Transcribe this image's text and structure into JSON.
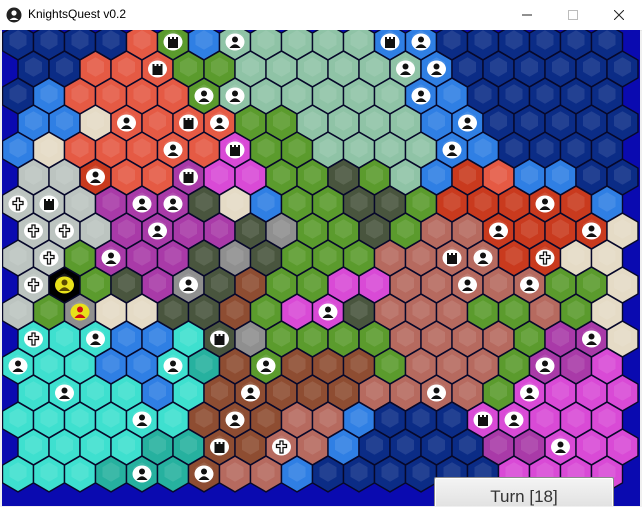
{
  "window": {
    "title": "KnightsQuest v0.2",
    "controls": {
      "minimize_icon": "minimize-icon",
      "maximize_icon": "maximize-icon",
      "close_icon": "close-icon"
    }
  },
  "map": {
    "cols": 20,
    "rows": 17,
    "terrain_colors": {
      "O": "#0b2c86",
      "W": "#2f7fe4",
      "R": "#e55a44",
      "D": "#c93a1e",
      "M": "#d94ad6",
      "P": "#a93aa8",
      "G": "#5b9b2d",
      "E": "#8fc3a6",
      "F": "#49553e",
      "S": "#e5dbc6",
      "K": "#bcc4c0",
      "T": "#3ee0cf",
      "C": "#26b19f",
      "B": "#8e4d32",
      "r": "#b66a5f",
      "L": "#8f8f8f"
    },
    "terrain": [
      "OOOORGWEEEEEWWOOOOOO",
      "OORRRGGEEEEEEWOOOOOO",
      "OWRRRRGEEEEEEWWOOOOO",
      "WWSRRRRGGEEEEWWOOOOO",
      "WSRRRRRMGGEEEEWWOOOO",
      "KKDRRPMMGGFGEWDRWWOO",
      "KKKPPPFSWGGFFGDDDDDW",
      "KKKPPPPFLGGFGrrDDDDS",
      "KKGPPPFLFGGGrrrrDDSS",
      "KYGFPLFBGGMMrrrrrGGS",
      "KGLSSFFBGMMFrrrGGrGS",
      "TTTWWTFLGGGGrrrrGPPS",
      "TTTWWTCBGBBBGrrrGPPM",
      "TTTTWTBBBBBrrrrGMMMM",
      "TTTTTTBBBrrWOOOMMMMM",
      "TTTTCCBBrrWOOOOPPMMM",
      "TTTCCCBrrWOOOOOOMMMM"
    ],
    "units": [
      {
        "col": 5,
        "row": 0,
        "kind": "castle"
      },
      {
        "col": 7,
        "row": 0,
        "kind": "warrior"
      },
      {
        "col": 12,
        "row": 0,
        "kind": "castle"
      },
      {
        "col": 13,
        "row": 0,
        "kind": "warrior"
      },
      {
        "col": 4,
        "row": 1,
        "kind": "castle"
      },
      {
        "col": 12,
        "row": 1,
        "kind": "warrior"
      },
      {
        "col": 13,
        "row": 1,
        "kind": "warrior"
      },
      {
        "col": 6,
        "row": 2,
        "kind": "warrior"
      },
      {
        "col": 7,
        "row": 2,
        "kind": "warrior"
      },
      {
        "col": 13,
        "row": 2,
        "kind": "warrior"
      },
      {
        "col": 3,
        "row": 3,
        "kind": "warrior"
      },
      {
        "col": 5,
        "row": 3,
        "kind": "tower"
      },
      {
        "col": 6,
        "row": 3,
        "kind": "warrior"
      },
      {
        "col": 14,
        "row": 3,
        "kind": "warrior"
      },
      {
        "col": 5,
        "row": 4,
        "kind": "warrior"
      },
      {
        "col": 7,
        "row": 4,
        "kind": "castle"
      },
      {
        "col": 14,
        "row": 4,
        "kind": "warrior"
      },
      {
        "col": 2,
        "row": 5,
        "kind": "warrior"
      },
      {
        "col": 5,
        "row": 5,
        "kind": "tower"
      },
      {
        "col": 0,
        "row": 6,
        "kind": "cross"
      },
      {
        "col": 1,
        "row": 6,
        "kind": "castle"
      },
      {
        "col": 4,
        "row": 6,
        "kind": "warrior"
      },
      {
        "col": 5,
        "row": 6,
        "kind": "warrior"
      },
      {
        "col": 17,
        "row": 6,
        "kind": "warrior"
      },
      {
        "col": 0,
        "row": 7,
        "kind": "cross"
      },
      {
        "col": 1,
        "row": 7,
        "kind": "cross"
      },
      {
        "col": 4,
        "row": 7,
        "kind": "warrior"
      },
      {
        "col": 15,
        "row": 7,
        "kind": "warrior"
      },
      {
        "col": 18,
        "row": 7,
        "kind": "warrior"
      },
      {
        "col": 1,
        "row": 8,
        "kind": "cross"
      },
      {
        "col": 3,
        "row": 8,
        "kind": "warrior"
      },
      {
        "col": 14,
        "row": 8,
        "kind": "castle"
      },
      {
        "col": 15,
        "row": 8,
        "kind": "warrior"
      },
      {
        "col": 17,
        "row": 8,
        "kind": "cross"
      },
      {
        "col": 0,
        "row": 9,
        "kind": "cross"
      },
      {
        "col": 1,
        "row": 9,
        "kind": "hero-yellow"
      },
      {
        "col": 5,
        "row": 9,
        "kind": "warrior"
      },
      {
        "col": 14,
        "row": 9,
        "kind": "warrior"
      },
      {
        "col": 16,
        "row": 9,
        "kind": "warrior"
      },
      {
        "col": 2,
        "row": 10,
        "kind": "hero-red"
      },
      {
        "col": 10,
        "row": 10,
        "kind": "warrior"
      },
      {
        "col": 0,
        "row": 11,
        "kind": "cross"
      },
      {
        "col": 2,
        "row": 11,
        "kind": "warrior"
      },
      {
        "col": 6,
        "row": 11,
        "kind": "castle"
      },
      {
        "col": 18,
        "row": 11,
        "kind": "warrior"
      },
      {
        "col": 0,
        "row": 12,
        "kind": "warrior"
      },
      {
        "col": 5,
        "row": 12,
        "kind": "warrior"
      },
      {
        "col": 8,
        "row": 12,
        "kind": "warrior"
      },
      {
        "col": 17,
        "row": 12,
        "kind": "warrior"
      },
      {
        "col": 1,
        "row": 13,
        "kind": "warrior"
      },
      {
        "col": 7,
        "row": 13,
        "kind": "warrior"
      },
      {
        "col": 13,
        "row": 13,
        "kind": "warrior"
      },
      {
        "col": 16,
        "row": 13,
        "kind": "warrior"
      },
      {
        "col": 4,
        "row": 14,
        "kind": "warrior"
      },
      {
        "col": 7,
        "row": 14,
        "kind": "warrior"
      },
      {
        "col": 15,
        "row": 14,
        "kind": "castle"
      },
      {
        "col": 16,
        "row": 14,
        "kind": "warrior"
      },
      {
        "col": 6,
        "row": 15,
        "kind": "castle"
      },
      {
        "col": 8,
        "row": 15,
        "kind": "cross"
      },
      {
        "col": 17,
        "row": 15,
        "kind": "warrior"
      },
      {
        "col": 4,
        "row": 16,
        "kind": "warrior"
      },
      {
        "col": 6,
        "row": 16,
        "kind": "warrior"
      }
    ]
  },
  "controls": {
    "turn_button": "Turn [18]"
  }
}
